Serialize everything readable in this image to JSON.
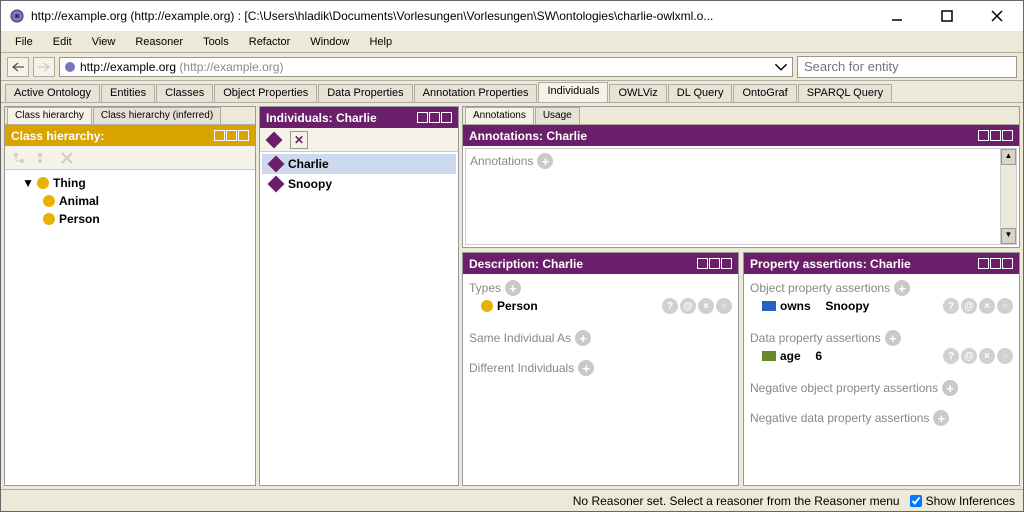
{
  "window": {
    "title": "http://example.org (http://example.org) : [C:\\Users\\hladik\\Documents\\Vorlesungen\\Vorlesungen\\SW\\ontologies\\charlie-owlxml.o..."
  },
  "menu": {
    "file": "File",
    "edit": "Edit",
    "view": "View",
    "reasoner": "Reasoner",
    "tools": "Tools",
    "refactor": "Refactor",
    "window": "Window",
    "help": "Help"
  },
  "url": {
    "main": "http://example.org",
    "paren": " (http://example.org)"
  },
  "search": {
    "placeholder": "Search for entity"
  },
  "maintabs": [
    "Active Ontology",
    "Entities",
    "Classes",
    "Object Properties",
    "Data Properties",
    "Annotation Properties",
    "Individuals",
    "OWLViz",
    "DL Query",
    "OntoGraf",
    "SPARQL Query"
  ],
  "maintabs_active": 6,
  "classhier": {
    "tabs": [
      "Class hierarchy",
      "Class hierarchy (inferred)"
    ],
    "title": "Class hierarchy:",
    "tree": [
      {
        "label": "Thing",
        "indent": 1,
        "expanded": true
      },
      {
        "label": "Animal",
        "indent": 2
      },
      {
        "label": "Person",
        "indent": 2
      }
    ]
  },
  "individuals": {
    "title": "Individuals: Charlie",
    "list": [
      {
        "label": "Charlie",
        "selected": true
      },
      {
        "label": "Snoopy",
        "selected": false
      }
    ]
  },
  "annotations": {
    "tabs": [
      "Annotations",
      "Usage"
    ],
    "title": "Annotations: Charlie",
    "label": "Annotations"
  },
  "description": {
    "title": "Description: Charlie",
    "types_label": "Types",
    "types": [
      {
        "label": "Person"
      }
    ],
    "same_label": "Same Individual As",
    "diff_label": "Different Individuals"
  },
  "property": {
    "title": "Property assertions: Charlie",
    "obj_label": "Object property assertions",
    "obj": [
      {
        "prop": "owns",
        "val": "Snoopy"
      }
    ],
    "data_label": "Data property assertions",
    "data": [
      {
        "prop": "age",
        "val": "6"
      }
    ],
    "neg_obj_label": "Negative object property assertions",
    "neg_data_label": "Negative data property assertions"
  },
  "status": {
    "reasoner": "No Reasoner set. Select a reasoner from the Reasoner menu",
    "show_inf": "Show Inferences"
  }
}
